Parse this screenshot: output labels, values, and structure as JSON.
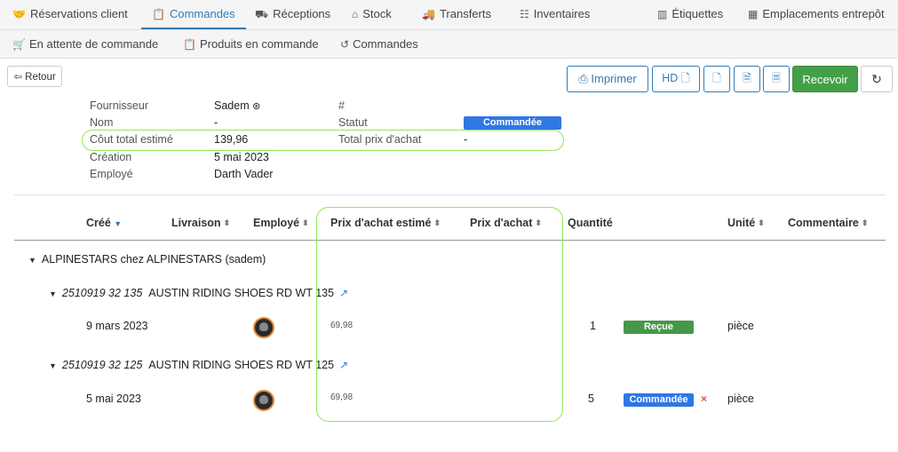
{
  "topnav": {
    "items": [
      {
        "label": "Réservations client",
        "icon": "handshake-icon"
      },
      {
        "label": "Commandes",
        "icon": "clipboard-icon",
        "active": true
      },
      {
        "label": "Réceptions",
        "icon": "dolly-icon"
      },
      {
        "label": "Stock",
        "icon": "warehouse-icon"
      },
      {
        "label": "Transferts",
        "icon": "truck-icon"
      },
      {
        "label": "Inventaires",
        "icon": "list-icon"
      },
      {
        "label": "Étiquettes",
        "icon": "barcode-icon"
      },
      {
        "label": "Emplacements entrepôt",
        "icon": "qrcode-icon"
      }
    ]
  },
  "subnav": {
    "items": [
      {
        "label": "En attente de commande",
        "icon": "cart-icon"
      },
      {
        "label": "Produits en commande",
        "icon": "clipboard-icon"
      },
      {
        "label": "Commandes",
        "icon": "history-icon"
      }
    ]
  },
  "toolbar": {
    "back_label": "Retour",
    "print_label": "Imprimer",
    "hd_label": "HD",
    "receive_label": "Recevoir"
  },
  "details": {
    "supplier_label": "Fournisseur",
    "supplier_value": "Sadem",
    "name_label": "Nom",
    "name_value": "-",
    "cost_label": "Côut total estimé",
    "cost_value": "139,96",
    "created_label": "Création",
    "created_value": "5 mai 2023",
    "employee_label": "Employé",
    "employee_value": "Darth Vader",
    "number_label": "#",
    "status_label": "Statut",
    "status_value": "Commandée",
    "total_label": "Total prix d'achat",
    "total_value": "-"
  },
  "table": {
    "headers": {
      "created": "Créé",
      "delivery": "Livraison",
      "employee": "Employé",
      "est_price": "Prix d'achat estimé",
      "price": "Prix d'achat",
      "qty": "Quantité",
      "unit": "Unité",
      "comment": "Commentaire"
    },
    "group": "ALPINESTARS chez ALPINESTARS (sadem)",
    "products": [
      {
        "ref": "2510919 32 135",
        "name": "AUSTIN RIDING SHOES RD WT 135",
        "date": "9 mars 2023",
        "est_price": "69,98",
        "qty": "1",
        "status": "Reçue",
        "unit": "pièce"
      },
      {
        "ref": "2510919 32 125",
        "name": "AUSTIN RIDING SHOES RD WT 125",
        "date": "5 mai 2023",
        "est_price": "69,98",
        "qty": "5",
        "status": "Commandée",
        "unit": "pièce"
      }
    ]
  },
  "colors": {
    "accent": "#337ab7",
    "success": "#43a047",
    "status_ordered": "#2f77e4",
    "highlight": "#8fe85a"
  }
}
